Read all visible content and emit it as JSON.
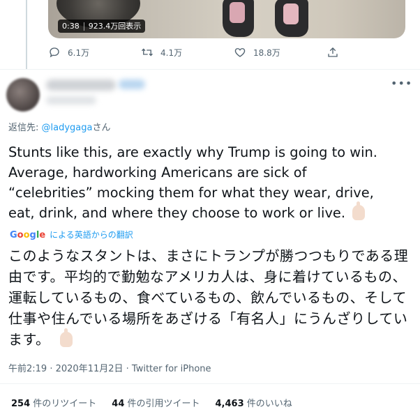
{
  "media": {
    "duration": "0:38",
    "views": "923.4万回表示"
  },
  "actions": {
    "reply_count": "6.1万",
    "retweet_count": "4.1万",
    "like_count": "18.8万"
  },
  "reply": {
    "prefix": "返信先: ",
    "mention": "@ladygaga",
    "suffix": "さん"
  },
  "tweet": {
    "text": "Stunts like this, are exactly why Trump is going to win.\nAverage, hardworking Americans are sick of\n“celebrities” mocking them for what they wear, drive,\neat, drink, and where they choose to work or live."
  },
  "translation": {
    "provider": "Google",
    "label": "による英語からの翻訳",
    "text": "このようなスタントは、まさにトランプが勝つつもりである理由です。平均的で勤勉なアメリカ人は、身に着けているもの、運転しているもの、食べているもの、飲んでいるもの、そして仕事や住んでいる場所をあざける「有名人」にうんざりしています。"
  },
  "meta": {
    "time": "午前2:19",
    "separator": "·",
    "date": "2020年11月2日",
    "source": "Twitter for iPhone"
  },
  "stats": {
    "retweets_num": "254",
    "retweets_label": " 件のリツイート",
    "quotes_num": "44",
    "quotes_label": " 件の引用ツイート",
    "likes_num": "4,463",
    "likes_label": " 件のいいね"
  },
  "icons": [
    "reply-icon",
    "retweet-icon",
    "like-icon",
    "share-icon",
    "more-icon",
    "emoji-hand-icon"
  ],
  "colors": {
    "link": "#1d9bf0",
    "muted": "#536471",
    "text": "#0f1419"
  }
}
